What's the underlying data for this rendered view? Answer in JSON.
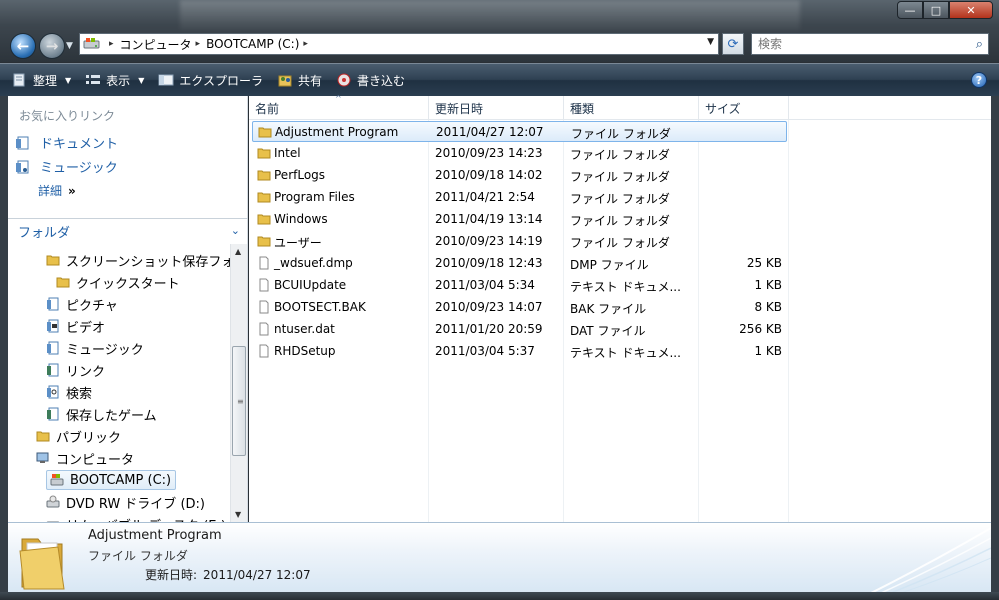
{
  "window": {
    "buttons": {
      "minimize": "—",
      "maximize": "□",
      "close": "✕"
    }
  },
  "nav": {
    "back_glyph": "←",
    "forward_glyph": "→"
  },
  "address": {
    "crumbs": [
      "コンピュータ",
      "BOOTCAMP (C:)"
    ],
    "separator": "▸"
  },
  "search": {
    "placeholder": "検索"
  },
  "toolbar": {
    "organize": "整理",
    "views": "表示",
    "explorer": "エクスプローラ",
    "share": "共有",
    "burn": "書き込む",
    "help": "?"
  },
  "left": {
    "favorites_header": "お気に入りリンク",
    "favorites": [
      "ドキュメント",
      "ミュージック"
    ],
    "more": "詳細",
    "more_chevron": "»",
    "folders_label": "フォルダ",
    "tree": [
      {
        "label": "スクリーンショット保存フォルダ",
        "indent": 2,
        "icon": "folder-icon"
      },
      {
        "label": "クイックスタート",
        "indent": 3,
        "icon": "folder-icon"
      },
      {
        "label": "ピクチャ",
        "indent": 2,
        "icon": "pictures-icon"
      },
      {
        "label": "ビデオ",
        "indent": 2,
        "icon": "videos-icon"
      },
      {
        "label": "ミュージック",
        "indent": 2,
        "icon": "music-icon"
      },
      {
        "label": "リンク",
        "indent": 2,
        "icon": "links-icon"
      },
      {
        "label": "検索",
        "indent": 2,
        "icon": "searches-icon"
      },
      {
        "label": "保存したゲーム",
        "indent": 2,
        "icon": "saved-games-icon"
      },
      {
        "label": "パブリック",
        "indent": 1,
        "icon": "folder-icon"
      },
      {
        "label": "コンピュータ",
        "indent": 1,
        "icon": "computer-icon"
      },
      {
        "label": "BOOTCAMP (C:)",
        "indent": 2,
        "icon": "drive-icon",
        "selected": true
      },
      {
        "label": "DVD RW ドライブ (D:)",
        "indent": 2,
        "icon": "dvd-drive-icon"
      },
      {
        "label": "リムーバブル ディスク (E:)",
        "indent": 2,
        "icon": "removable-disk-icon"
      }
    ]
  },
  "files": {
    "columns": [
      "名前",
      "更新日時",
      "種類",
      "サイズ"
    ],
    "rows": [
      {
        "name": "Adjustment Program",
        "date": "2011/04/27 12:07",
        "type": "ファイル フォルダ",
        "size": "",
        "kind": "folder",
        "selected": true
      },
      {
        "name": "Intel",
        "date": "2010/09/23 14:23",
        "type": "ファイル フォルダ",
        "size": "",
        "kind": "folder"
      },
      {
        "name": "PerfLogs",
        "date": "2010/09/18 14:02",
        "type": "ファイル フォルダ",
        "size": "",
        "kind": "folder"
      },
      {
        "name": "Program Files",
        "date": "2011/04/21 2:54",
        "type": "ファイル フォルダ",
        "size": "",
        "kind": "folder"
      },
      {
        "name": "Windows",
        "date": "2011/04/19 13:14",
        "type": "ファイル フォルダ",
        "size": "",
        "kind": "folder"
      },
      {
        "name": "ユーザー",
        "date": "2010/09/23 14:19",
        "type": "ファイル フォルダ",
        "size": "",
        "kind": "folder"
      },
      {
        "name": "_wdsuef.dmp",
        "date": "2010/09/18 12:43",
        "type": "DMP ファイル",
        "size": "25 KB",
        "kind": "file"
      },
      {
        "name": "BCUIUpdate",
        "date": "2011/03/04 5:34",
        "type": "テキスト ドキュメ...",
        "size": "1 KB",
        "kind": "file"
      },
      {
        "name": "BOOTSECT.BAK",
        "date": "2010/09/23 14:07",
        "type": "BAK ファイル",
        "size": "8 KB",
        "kind": "file"
      },
      {
        "name": "ntuser.dat",
        "date": "2011/01/20 20:59",
        "type": "DAT ファイル",
        "size": "256 KB",
        "kind": "file"
      },
      {
        "name": "RHDSetup",
        "date": "2011/03/04 5:37",
        "type": "テキスト ドキュメ...",
        "size": "1 KB",
        "kind": "file"
      }
    ]
  },
  "details": {
    "name": "Adjustment Program",
    "type": "ファイル フォルダ",
    "modified_label": "更新日時:",
    "modified_value": "2011/04/27 12:07"
  },
  "colors": {
    "link_blue": "#1f5fa6",
    "selection_border": "#7eb4ea",
    "folder_yellow": "#e8c04a"
  }
}
